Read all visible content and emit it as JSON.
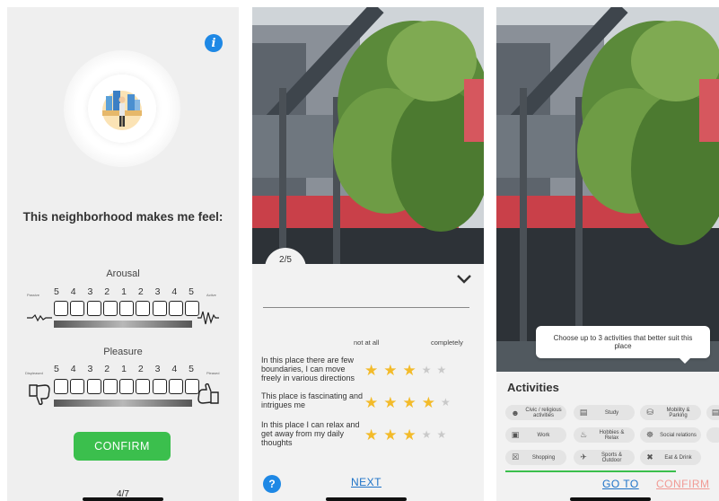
{
  "panel1": {
    "info_icon": "i",
    "question": "This neighborhood makes me feel:",
    "arousal": {
      "title": "Arousal",
      "numbers": [
        "5",
        "4",
        "3",
        "2",
        "1",
        "2",
        "3",
        "4",
        "5"
      ],
      "left_label": "Passive",
      "right_label": "Active"
    },
    "pleasure": {
      "title": "Pleasure",
      "numbers": [
        "5",
        "4",
        "3",
        "2",
        "1",
        "2",
        "3",
        "4",
        "5"
      ],
      "left_label": "Displeased",
      "right_label": "Pleased"
    },
    "confirm_label": "CONFIRM",
    "page_indicator": "4/7"
  },
  "panel2": {
    "step": "2/5",
    "scale_low": "not at all",
    "scale_high": "completely",
    "statements": [
      {
        "text": "In this place there are few boundaries, I can move freely in various directions",
        "rating": 3
      },
      {
        "text": "This place is fascinating and intrigues me",
        "rating": 4
      },
      {
        "text": "In this place I can relax and get away from my daily thoughts",
        "rating": 3
      }
    ],
    "max_rating": 5,
    "help_icon": "?",
    "next_label": "NEXT"
  },
  "panel3": {
    "tooltip": "Choose up to 3 activities that better suit this place",
    "title": "Activities",
    "chips": [
      {
        "label": "Civic / religious activities",
        "icon": "people-icon"
      },
      {
        "label": "Study",
        "icon": "book-icon"
      },
      {
        "label": "Mobility & Parking",
        "icon": "car-icon"
      },
      {
        "label": "Work",
        "icon": "briefcase-icon"
      },
      {
        "label": "Hobbies & Relax",
        "icon": "relax-icon"
      },
      {
        "label": "Social relations",
        "icon": "group-icon"
      },
      {
        "label": "Shopping",
        "icon": "cart-icon"
      },
      {
        "label": "Sports & Outdoor",
        "icon": "running-icon"
      },
      {
        "label": "Eat & Drink",
        "icon": "cutlery-icon"
      }
    ],
    "goto_label": "GO TO",
    "confirm_label": "CONFIRM"
  },
  "colors": {
    "green": "#3bbf4d",
    "blue": "#1e88e5",
    "link_blue": "#1e73c8",
    "star": "#f3bb2a",
    "confirm_pink": "#f19a94"
  }
}
